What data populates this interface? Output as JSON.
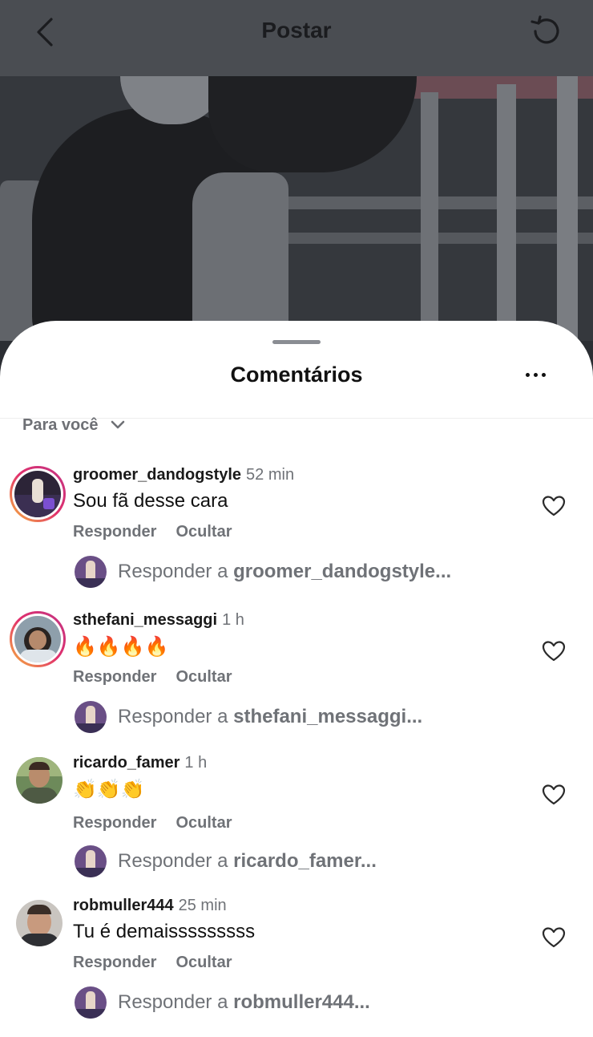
{
  "header": {
    "title": "Postar"
  },
  "sheet": {
    "title": "Comentários"
  },
  "filter": {
    "label": "Para você"
  },
  "comments": [
    {
      "username": "groomer_dandogstyle",
      "time": "52 min",
      "text": "Sou fã desse cara",
      "reply_label": "Responder",
      "hide_label": "Ocultar",
      "reply_prefix": "Responder a",
      "reply_target": "groomer_dandogstyle..."
    },
    {
      "username": "sthefani_messaggi",
      "time": "1 h",
      "text": "🔥🔥🔥🔥",
      "reply_label": "Responder",
      "hide_label": "Ocultar",
      "reply_prefix": "Responder a",
      "reply_target": "sthefani_messaggi..."
    },
    {
      "username": "ricardo_famer",
      "time": "1 h",
      "text": "👏👏👏",
      "reply_label": "Responder",
      "hide_label": "Ocultar",
      "reply_prefix": "Responder a",
      "reply_target": "ricardo_famer..."
    },
    {
      "username": "robmuller444",
      "time": "25 min",
      "text": "Tu é demaisssssssss",
      "reply_label": "Responder",
      "hide_label": "Ocultar",
      "reply_prefix": "Responder a",
      "reply_target": "robmuller444..."
    }
  ],
  "icons": {
    "back": "chevron-left-icon",
    "refresh": "refresh-icon",
    "more": "more-horizontal-icon",
    "filter_chevron": "chevron-down-icon",
    "like": "heart-icon"
  },
  "colors": {
    "story_ring_start": "#f6b73c",
    "story_ring_end": "#c13584",
    "muted_text": "#6f7277"
  }
}
